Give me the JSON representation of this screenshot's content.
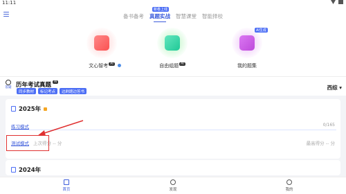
{
  "status": {
    "time": "11:11"
  },
  "tabs": [
    {
      "label": "备书备考"
    },
    {
      "label": "真题实战",
      "badge": "新卷上线"
    },
    {
      "label": "智慧课堂"
    },
    {
      "label": "智能择校"
    }
  ],
  "features": [
    {
      "label": "文心智考",
      "mini": "AI"
    },
    {
      "label": "自由组题",
      "mini": "AI"
    },
    {
      "label": "我的题集",
      "badge": "AI生成"
    }
  ],
  "exam": {
    "bulb_text": "答疑",
    "title": "历年考试真题",
    "title_mini": "AI",
    "chips": [
      "同步教材",
      "标记考点",
      "边刷题边答书"
    ],
    "region": "西综 ▾"
  },
  "card1": {
    "year": "2025年",
    "practice_label": "练习模式",
    "progress_text": "0/165",
    "progress_fraction": 0,
    "test_label": "测试模式",
    "last_score": "上次得分 -- 分",
    "best_score": "最高得分 -- 分"
  },
  "card2": {
    "year": "2024年"
  },
  "nav": [
    {
      "label": "首页"
    },
    {
      "label": "发现"
    },
    {
      "label": "我的"
    }
  ],
  "colors": {
    "accent": "#3b5bdb",
    "annotation": "#e03131"
  }
}
